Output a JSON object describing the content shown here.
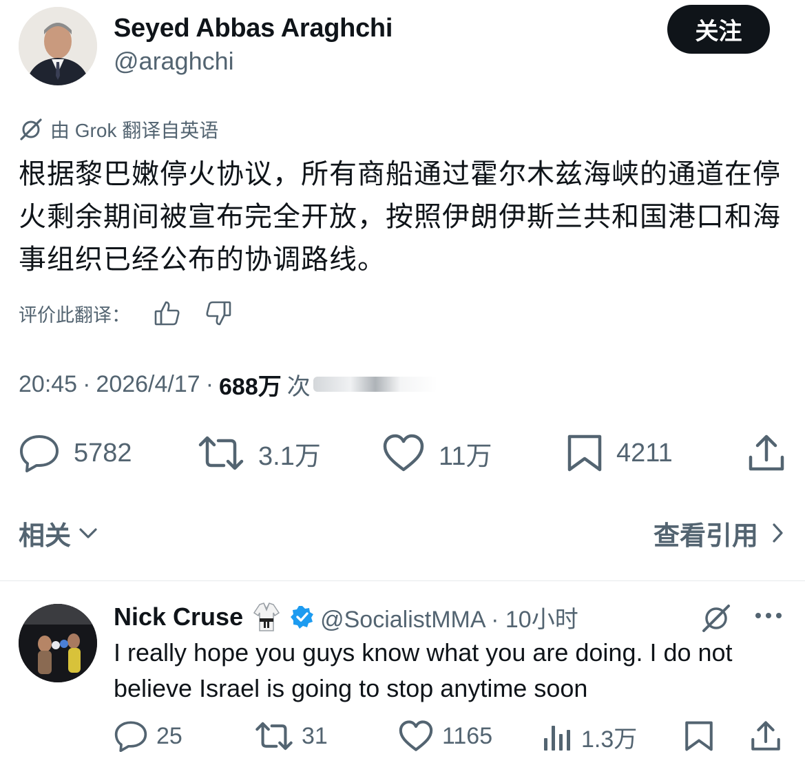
{
  "author": {
    "name": "Seyed Abbas Araghchi",
    "handle": "@araghchi",
    "follow_label": "关注"
  },
  "translation": {
    "note": "由 Grok 翻译自英语",
    "text": "根据黎巴嫩停火协议，所有商船通过霍尔木兹海峡的通道在停火剩余期间被宣布完全开放，按照伊朗伊斯兰共和国港口和海事组织已经公布的协调路线。",
    "rate_label": "评价此翻译："
  },
  "meta": {
    "time": "20:45",
    "date": "2026/4/17",
    "views_count": "688万",
    "views_label": "次"
  },
  "actions": {
    "replies": "5782",
    "reposts": "3.1万",
    "likes": "11万",
    "bookmarks": "4211"
  },
  "related_label": "相关",
  "view_quotes_label": "查看引用",
  "reply": {
    "name": "Nick Cruse",
    "handle_time": "@SocialistMMA · 10小时",
    "text": "I really hope you guys know what you are doing. I do not believe Israel is going to stop anytime soon",
    "replies": "25",
    "reposts": "31",
    "likes": "1165",
    "views": "1.3万"
  }
}
